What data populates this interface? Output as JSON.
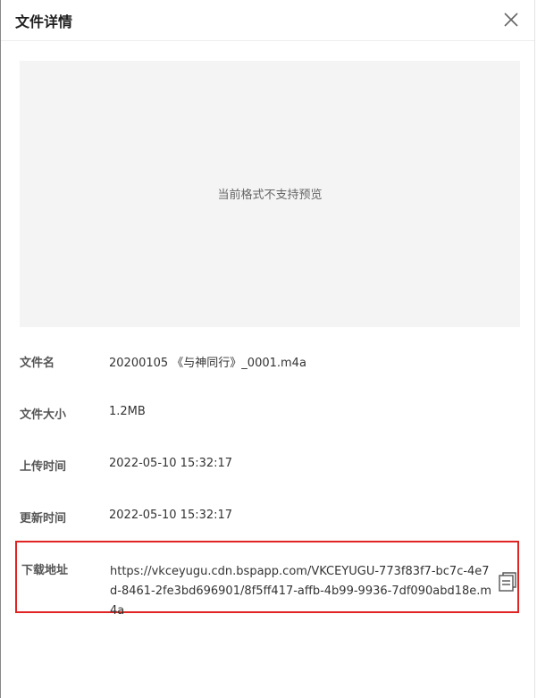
{
  "header": {
    "title": "文件详情"
  },
  "preview": {
    "message": "当前格式不支持预览"
  },
  "details": [
    {
      "label": "文件名",
      "value": "20200105 《与神同行》_0001.m4a"
    },
    {
      "label": "文件大小",
      "value": "1.2MB"
    },
    {
      "label": "上传时间",
      "value": "2022-05-10 15:32:17"
    },
    {
      "label": "更新时间",
      "value": "2022-05-10 15:32:17"
    }
  ],
  "download": {
    "label": "下载地址",
    "url": "https://vkceyugu.cdn.bspapp.com/VKCEYUGU-773f83f7-bc7c-4e7d-8461-2fe3bd696901/8f5ff417-affb-4b99-9936-7df090abd18e.m4a"
  },
  "colors": {
    "highlight_border": "#e02424",
    "preview_bg": "#f4f4f4"
  },
  "icons": {
    "close": "close-icon",
    "copy": "copy-icon"
  }
}
